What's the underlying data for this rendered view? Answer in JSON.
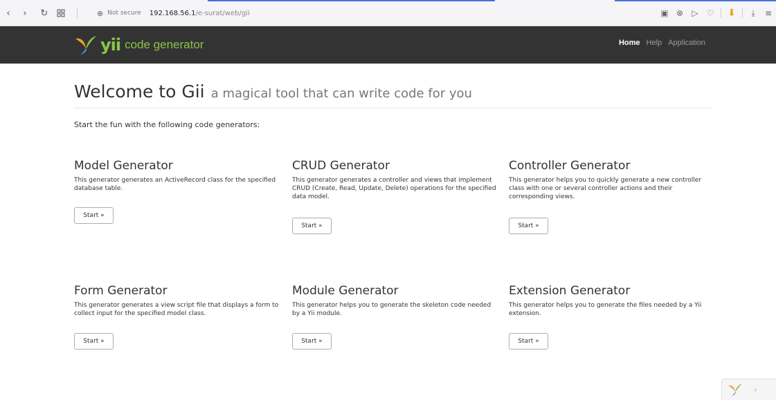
{
  "browser": {
    "not_secure": "Not secure",
    "url_host": "192.168.56.1",
    "url_path": "/e-surat/web/gii"
  },
  "navbar": {
    "brand_yii": "yii",
    "brand_text": "code generator",
    "links": [
      {
        "label": "Home",
        "active": true
      },
      {
        "label": "Help",
        "active": false
      },
      {
        "label": "Application",
        "active": false
      }
    ]
  },
  "page": {
    "title": "Welcome to Gii",
    "subtitle": "a magical tool that can write code for you",
    "lead": "Start the fun with the following code generators:"
  },
  "generators": [
    {
      "title": "Model Generator",
      "description": "This generator generates an ActiveRecord class for the specified database table.",
      "button": "Start »"
    },
    {
      "title": "CRUD Generator",
      "description": "This generator generates a controller and views that implement CRUD (Create, Read, Update, Delete) operations for the specified data model.",
      "button": "Start »"
    },
    {
      "title": "Controller Generator",
      "description": "This generator helps you to quickly generate a new controller class with one or several controller actions and their corresponding views.",
      "button": "Start »"
    },
    {
      "title": "Form Generator",
      "description": "This generator generates a view script file that displays a form to collect input for the specified model class.",
      "button": "Start »"
    },
    {
      "title": "Module Generator",
      "description": "This generator helps you to generate the skeleton code needed by a Yii module.",
      "button": "Start »"
    },
    {
      "title": "Extension Generator",
      "description": "This generator helps you to generate the files needed by a Yii extension.",
      "button": "Start »"
    }
  ],
  "colors": {
    "navbar_bg": "#333333",
    "brand_green": "#8bc34a",
    "active_link": "#ffffff",
    "inactive_link": "#9d9d9d"
  }
}
